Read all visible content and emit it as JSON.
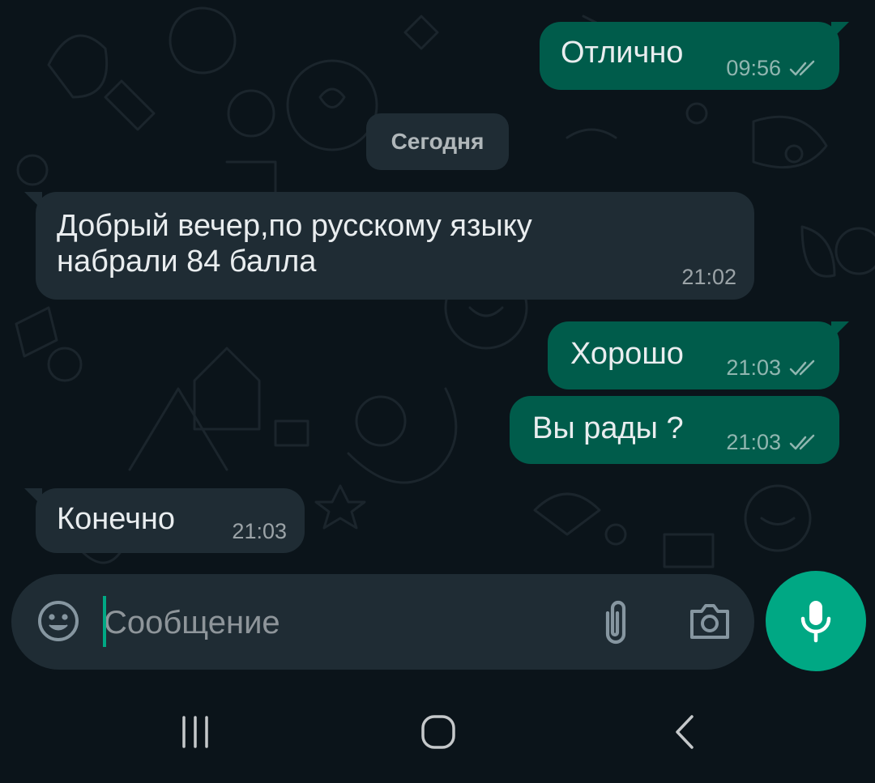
{
  "date_separator": "Сегодня",
  "messages": [
    {
      "direction": "out",
      "text": "Отлично",
      "time": "09:56",
      "status_icon": "double-check-icon"
    },
    {
      "direction": "in",
      "text": "Добрый вечер,по русскому языку\nнабрали 84 балла",
      "time": "21:02"
    },
    {
      "direction": "out",
      "text": "Хорошо",
      "time": "21:03",
      "status_icon": "double-check-icon"
    },
    {
      "direction": "out",
      "text": "Вы рады ?",
      "time": "21:03",
      "status_icon": "double-check-icon"
    },
    {
      "direction": "in",
      "text": "Конечно",
      "time": "21:03"
    }
  ],
  "composer": {
    "placeholder": "Сообщение",
    "value": "",
    "emoji_icon": "smiley-icon",
    "attach_icon": "paperclip-icon",
    "camera_icon": "camera-icon",
    "send_icon": "microphone-icon"
  },
  "navigation": {
    "recents_icon": "recents-icon",
    "home_icon": "home-icon",
    "back_icon": "back-icon"
  },
  "colors": {
    "background": "#0b141a",
    "outgoing_bubble": "#005c4b",
    "incoming_bubble": "#1f2c34",
    "accent": "#00a884",
    "text": "#e9edef"
  }
}
